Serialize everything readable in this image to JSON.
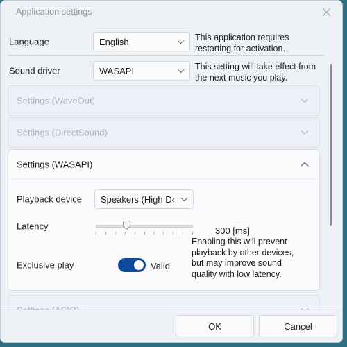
{
  "window": {
    "title": "Application settings",
    "close_icon": "close-icon"
  },
  "general": {
    "language": {
      "label": "Language",
      "value": "English",
      "hint": "This application requires restarting for activation."
    },
    "sound_driver": {
      "label": "Sound driver",
      "value": "WASAPI",
      "hint": "This setting will take effect from the next music you play."
    }
  },
  "sections": [
    {
      "title": "Settings (WaveOut)",
      "expanded": false,
      "chevron": "chevron-down-icon"
    },
    {
      "title": "Settings (DirectSound)",
      "expanded": false,
      "chevron": "chevron-down-icon"
    },
    {
      "title": "Settings (WASAPI)",
      "expanded": true,
      "chevron": "chevron-up-icon"
    },
    {
      "title": "Settings (ASIO)",
      "expanded": false,
      "chevron": "chevron-down-icon"
    }
  ],
  "wasapi": {
    "playback_device": {
      "label": "Playback device",
      "value": "Speakers (High D‹"
    },
    "latency": {
      "label": "Latency",
      "value": "300 [ms]",
      "slider_percent": 30
    },
    "exclusive_play": {
      "label": "Exclusive play",
      "state": "Valid",
      "on": true,
      "hint": "Enabling this will prevent playback by other devices, but may improve sound quality with low latency."
    }
  },
  "footer": {
    "ok": "OK",
    "cancel": "Cancel"
  },
  "colors": {
    "accent": "#10499a",
    "window_bg": "#eef2f7",
    "card_collapsed_bg": "#eef1f7",
    "card_expanded_bg": "#fbfbfd",
    "desktop_bg": "#2f6d80"
  }
}
